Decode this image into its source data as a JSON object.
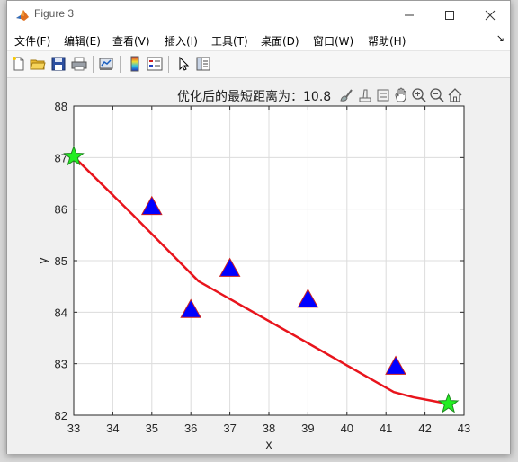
{
  "window": {
    "title": "Figure 3"
  },
  "menu": {
    "items": [
      "文件(F)",
      "编辑(E)",
      "查看(V)",
      "插入(I)",
      "工具(T)",
      "桌面(D)",
      "窗口(W)",
      "帮助(H)"
    ],
    "more_arrow": "↘"
  },
  "toolbar": {
    "buttons": [
      "new-figure",
      "open-file",
      "save",
      "print",
      "link-plot",
      "insert-colorbar",
      "insert-legend",
      "edit-plot",
      "property-inspector"
    ]
  },
  "axes_toolbar": {
    "buttons": [
      "brush",
      "data-tips",
      "export",
      "pan",
      "zoom-in",
      "zoom-out",
      "home"
    ]
  },
  "chart_data": {
    "type": "line",
    "title": "优化后的最短距离为：10.8",
    "xlabel": "x",
    "ylabel": "y",
    "xlim": [
      33,
      43
    ],
    "ylim": [
      82,
      88
    ],
    "xticks": [
      33,
      34,
      35,
      36,
      37,
      38,
      39,
      40,
      41,
      42,
      43
    ],
    "yticks": [
      82,
      83,
      84,
      85,
      86,
      87,
      88
    ],
    "grid": true,
    "route_line": {
      "color": "#e8141c",
      "x": [
        33.0,
        34.5,
        36.2,
        39.0,
        41.2,
        41.7,
        42.6
      ],
      "y": [
        87.02,
        85.9,
        84.6,
        83.4,
        82.45,
        82.35,
        82.22
      ]
    },
    "triangle_points": {
      "color": "#0000ff",
      "edge": "#cc2222",
      "x": [
        35.0,
        36.0,
        37.0,
        39.0,
        41.25
      ],
      "y": [
        86.05,
        84.05,
        84.85,
        84.25,
        82.95
      ]
    },
    "star_points": {
      "color": "#22ee22",
      "edge": "#208a20",
      "x": [
        33.0,
        42.6
      ],
      "y": [
        87.02,
        82.22
      ]
    }
  }
}
